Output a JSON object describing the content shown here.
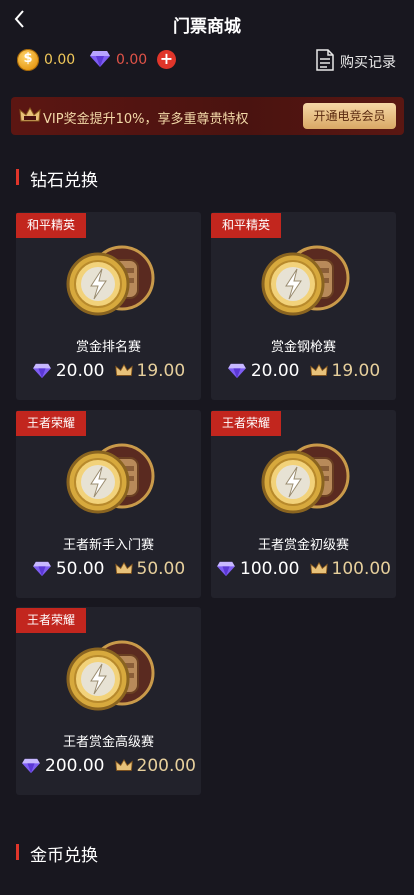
{
  "header": {
    "title": "门票商城",
    "back_icon": "chevron-left-icon"
  },
  "balance": {
    "coin_icon": "gold-coin-icon",
    "coin_symbol": "$",
    "coin_value": "0.00",
    "diamond_icon": "diamond-icon",
    "diamond_value": "0.00",
    "add_icon": "plus-icon",
    "add_label": "+",
    "record_icon": "receipt-icon",
    "record_label": "购买记录"
  },
  "vip_banner": {
    "icon": "vip-crown-icon",
    "text": "VIP奖金提升10%，享多重尊贵特权",
    "button_label": "开通电竞会员"
  },
  "sections": {
    "diamond": {
      "title": "钻石兑换"
    },
    "coin": {
      "title": "金币兑换"
    }
  },
  "cards": [
    {
      "tag": "和平精英",
      "name": "赏金排名赛",
      "diamond_price": "20.00",
      "crown_price": "19.00"
    },
    {
      "tag": "和平精英",
      "name": "赏金钢枪赛",
      "diamond_price": "20.00",
      "crown_price": "19.00"
    },
    {
      "tag": "王者荣耀",
      "name": "王者新手入门赛",
      "diamond_price": "50.00",
      "crown_price": "50.00"
    },
    {
      "tag": "王者荣耀",
      "name": "王者赏金初级赛",
      "diamond_price": "100.00",
      "crown_price": "100.00"
    },
    {
      "tag": "王者荣耀",
      "name": "王者赏金高级赛",
      "diamond_price": "200.00",
      "crown_price": "200.00"
    }
  ],
  "colors": {
    "background": "#18171f",
    "card": "#22222b",
    "accent_red": "#c2261e",
    "gold": "#f0c85a",
    "diamond_value": "#e05348"
  }
}
